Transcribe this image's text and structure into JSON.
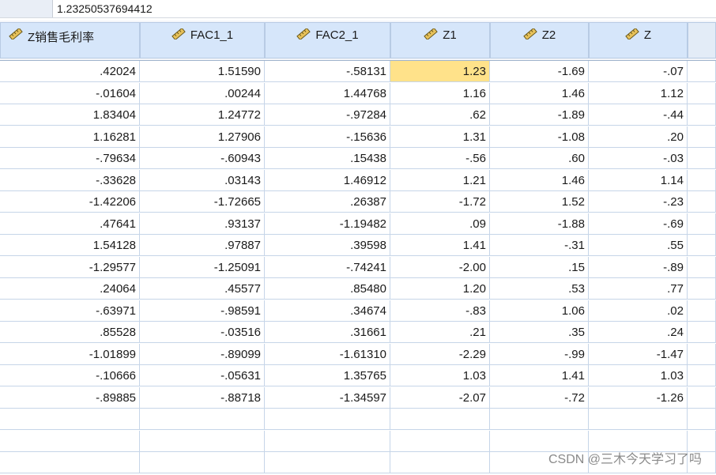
{
  "cell_editor": {
    "value": "1.23250537694412"
  },
  "columns": [
    {
      "name": "Z销售毛利率",
      "icon": "scale-ruler-icon"
    },
    {
      "name": "FAC1_1",
      "icon": "scale-ruler-icon"
    },
    {
      "name": "FAC2_1",
      "icon": "scale-ruler-icon"
    },
    {
      "name": "Z1",
      "icon": "scale-ruler-icon"
    },
    {
      "name": "Z2",
      "icon": "scale-ruler-icon"
    },
    {
      "name": "Z",
      "icon": "scale-ruler-icon"
    }
  ],
  "rows": [
    [
      ".42024",
      "1.51590",
      "-.58131",
      "1.23",
      "-1.69",
      "-.07"
    ],
    [
      "-.01604",
      ".00244",
      "1.44768",
      "1.16",
      "1.46",
      "1.12"
    ],
    [
      "1.83404",
      "1.24772",
      "-.97284",
      ".62",
      "-1.89",
      "-.44"
    ],
    [
      "1.16281",
      "1.27906",
      "-.15636",
      "1.31",
      "-1.08",
      ".20"
    ],
    [
      "-.79634",
      "-.60943",
      ".15438",
      "-.56",
      ".60",
      "-.03"
    ],
    [
      "-.33628",
      ".03143",
      "1.46912",
      "1.21",
      "1.46",
      "1.14"
    ],
    [
      "-1.42206",
      "-1.72665",
      ".26387",
      "-1.72",
      "1.52",
      "-.23"
    ],
    [
      ".47641",
      ".93137",
      "-1.19482",
      ".09",
      "-1.88",
      "-.69"
    ],
    [
      "1.54128",
      ".97887",
      ".39598",
      "1.41",
      "-.31",
      ".55"
    ],
    [
      "-1.29577",
      "-1.25091",
      "-.74241",
      "-2.00",
      ".15",
      "-.89"
    ],
    [
      ".24064",
      ".45577",
      ".85480",
      "1.20",
      ".53",
      ".77"
    ],
    [
      "-.63971",
      "-.98591",
      ".34674",
      "-.83",
      "1.06",
      ".02"
    ],
    [
      ".85528",
      "-.03516",
      ".31661",
      ".21",
      ".35",
      ".24"
    ],
    [
      "-1.01899",
      "-.89099",
      "-1.61310",
      "-2.29",
      "-.99",
      "-1.47"
    ],
    [
      "-.10666",
      "-.05631",
      "1.35765",
      "1.03",
      "1.41",
      "1.03"
    ],
    [
      "-.89885",
      "-.88718",
      "-1.34597",
      "-2.07",
      "-.72",
      "-1.26"
    ],
    [
      "",
      "",
      "",
      "",
      "",
      ""
    ],
    [
      "",
      "",
      "",
      "",
      "",
      ""
    ],
    [
      "",
      "",
      "",
      "",
      "",
      ""
    ]
  ],
  "selected_cell": {
    "row": 0,
    "col": 3
  },
  "watermark": "CSDN @三木今天学习了吗",
  "colors": {
    "header_bg": "#d6e6fa",
    "grid_line": "#c6d5e8",
    "selection": "#ffe28a"
  }
}
